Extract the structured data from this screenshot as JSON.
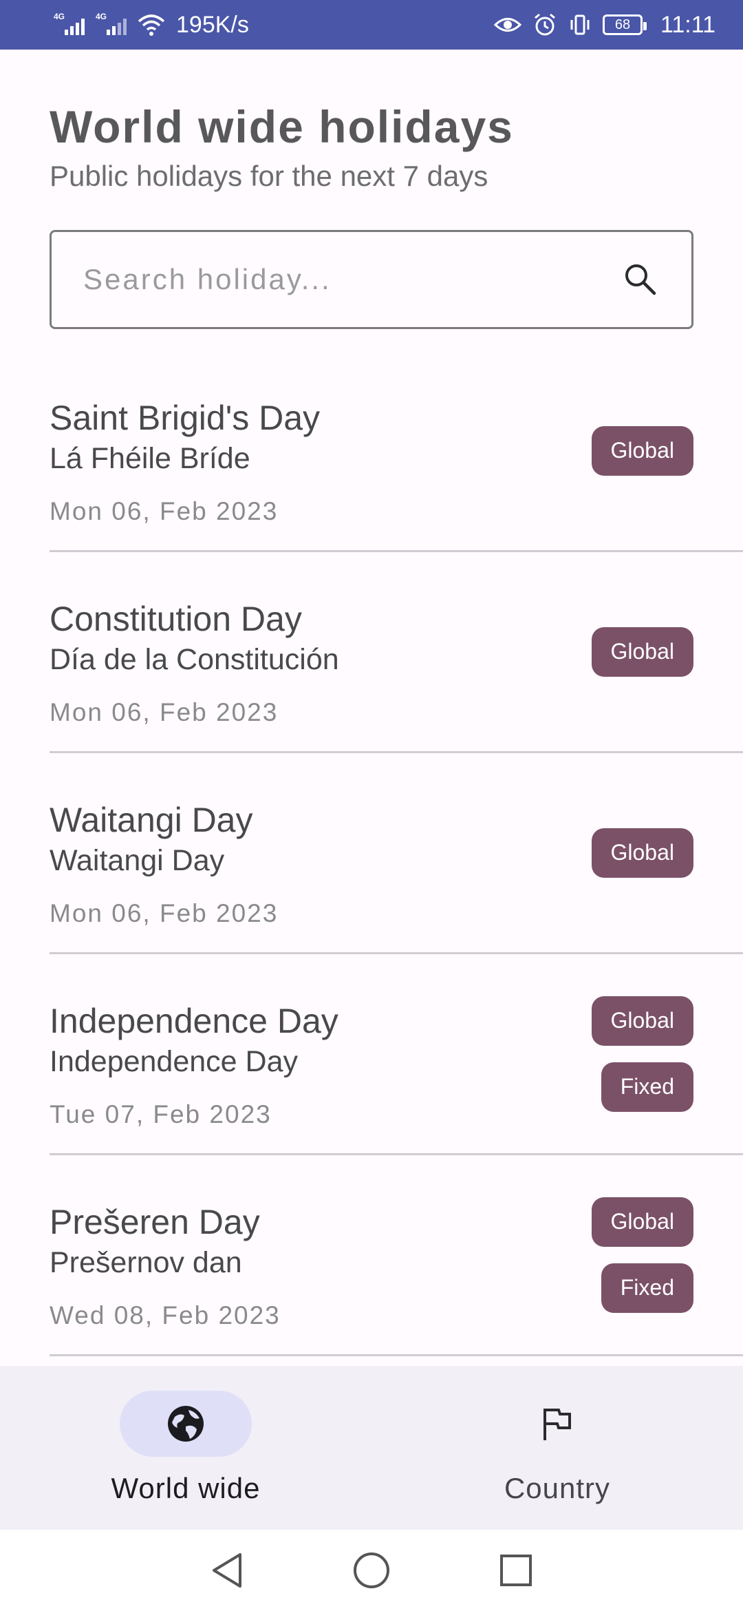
{
  "status_bar": {
    "net_speed": "195K/s",
    "battery": "68",
    "time": "11:11",
    "signal_tag_1": "4G",
    "signal_tag_2": "4G"
  },
  "header": {
    "title": "World wide holidays",
    "subtitle": "Public holidays for the next 7 days"
  },
  "search": {
    "placeholder": "Search holiday...",
    "value": "",
    "icon": "search-icon"
  },
  "holidays": [
    {
      "name": "Saint Brigid's Day",
      "local_name": "Lá Fhéile Bríde",
      "date": "Mon 06, Feb 2023",
      "badges": [
        "Global"
      ]
    },
    {
      "name": "Constitution Day",
      "local_name": "Día de la Constitución",
      "date": "Mon 06, Feb 2023",
      "badges": [
        "Global"
      ]
    },
    {
      "name": "Waitangi Day",
      "local_name": "Waitangi Day",
      "date": "Mon 06, Feb 2023",
      "badges": [
        "Global"
      ]
    },
    {
      "name": "Independence Day",
      "local_name": "Independence Day",
      "date": "Tue 07, Feb 2023",
      "badges": [
        "Global",
        "Fixed"
      ]
    },
    {
      "name": "Prešeren Day",
      "local_name": "Prešernov dan",
      "date": "Wed 08, Feb 2023",
      "badges": [
        "Global",
        "Fixed"
      ]
    }
  ],
  "bottom_nav": {
    "items": [
      {
        "label": "World wide",
        "icon": "globe-icon",
        "active": true
      },
      {
        "label": "Country",
        "icon": "flag-icon",
        "active": false
      }
    ]
  },
  "colors": {
    "status_bar": "#4a56a8",
    "badge": "#7b5168",
    "nav_active_pill": "#dfe0f8",
    "nav_background": "#f2eff7"
  }
}
